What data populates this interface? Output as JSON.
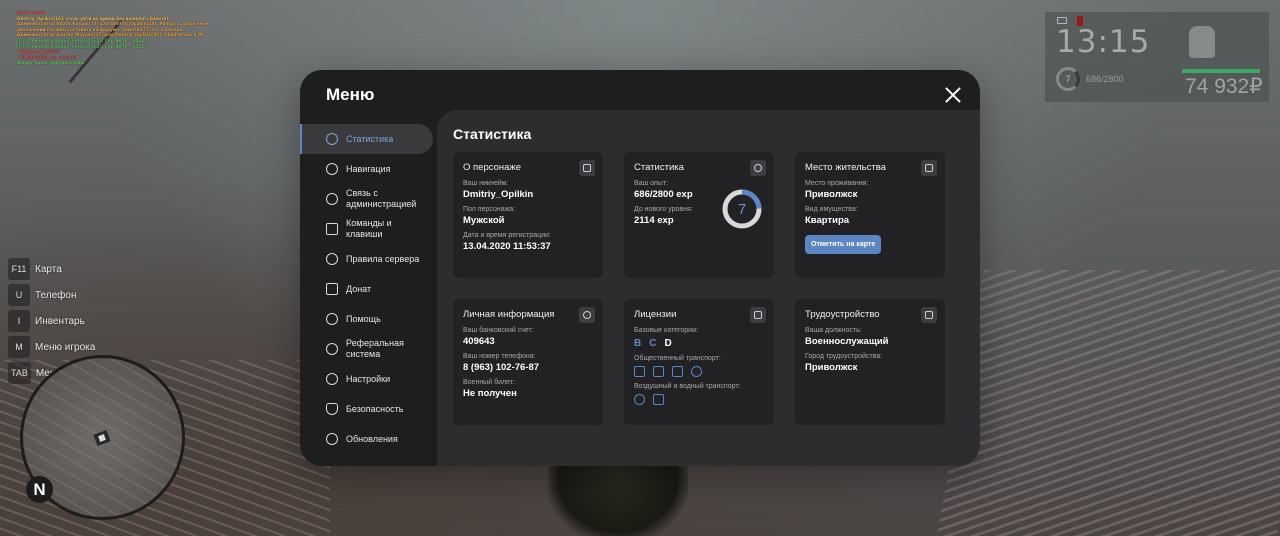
{
  "chat": [
    {
      "text": "Дым Финай",
      "color": "#e05050"
    },
    {
      "text": "Dmitriy_Opilkin[18]: а как уйти из армии без военного билета?",
      "color": "#f0c050"
    },
    {
      "text": "Администратор Nikita_Kanpai[73] для Dmitriy_Opilkin[48]: Рапорт о досрочном",
      "color": "#f0a040"
    },
    {
      "text": "увольнении службы составить на форуме. Заметил ГС.Ч.С о беседе.",
      "color": "#f0a040"
    },
    {
      "text": "Администратор Andrey_Milyaev[27] для Dmitriy_Opilkin[48]: Обратитесь к РС.",
      "color": "#f0a040"
    },
    {
      "text": "[C] Отличная Vladimir_Fetisov[165]: Сер ЯКТР - 2433 !!",
      "color": "#60c060"
    },
    {
      "text": "[C] Отличная Vladimir_Fetisov[165]: Сер ЯКТР - 2433 !!",
      "color": "#60c060"
    },
    {
      "text": "* Время: 11:50:57",
      "color": "#e05050"
    },
    {
      "text": "* 29.09.2020, Вс, 7:37:37",
      "color": "#e05050"
    },
    {
      "text": "Alexey_Loew: был разогнан.",
      "color": "#60d060"
    }
  ],
  "hud": {
    "time": "13:15",
    "level": "7",
    "exp": "686/2800",
    "money": "74 932₽",
    "health_fraction": 1.0
  },
  "keys": [
    {
      "key": "F11",
      "label": "Карта"
    },
    {
      "key": "U",
      "label": "Телефон"
    },
    {
      "key": "I",
      "label": "Инвентарь"
    },
    {
      "key": "M",
      "label": "Меню игрока"
    },
    {
      "key": "TAB",
      "label": "Меню взаимодействия"
    }
  ],
  "minimap": {
    "compass": "N"
  },
  "menu": {
    "title": "Меню",
    "sidebar": [
      {
        "label": "Статистика",
        "icon": "pie-chart-icon",
        "active": true
      },
      {
        "label": "Навигация",
        "icon": "compass-icon"
      },
      {
        "label": "Связь с администрацией",
        "icon": "headset-icon"
      },
      {
        "label": "Команды и клавиши",
        "icon": "document-icon"
      },
      {
        "label": "Правила сервера",
        "icon": "scales-icon"
      },
      {
        "label": "Донат",
        "icon": "wallet-icon"
      },
      {
        "label": "Помощь",
        "icon": "heart-hand-icon"
      },
      {
        "label": "Реферальная система",
        "icon": "people-icon"
      },
      {
        "label": "Настройки",
        "icon": "gear-icon"
      },
      {
        "label": "Безопасность",
        "icon": "shield-icon"
      },
      {
        "label": "Обновления",
        "icon": "refresh-icon"
      }
    ],
    "panel_title": "Статистика",
    "character": {
      "title": "О персонаже",
      "nickname_label": "Ваш никнейм:",
      "nickname": "Dmitriy_Opilkin",
      "sex_label": "Пол персонажа:",
      "sex": "Мужской",
      "reg_label": "Дата и время регистрации:",
      "reg": "13.04.2020 11:53:37"
    },
    "stats": {
      "title": "Статистика",
      "exp_label": "Ваш опыт:",
      "exp": "686/2800 exp",
      "next_label": "До нового уровня:",
      "next": "2114 exp",
      "level": "7",
      "progress": 0.245
    },
    "residence": {
      "title": "Место жительства",
      "place_label": "Место проживания:",
      "place": "Приволжск",
      "property_label": "Вид имущества:",
      "property": "Квартира",
      "button": "Отметить на карте"
    },
    "personal": {
      "title": "Личная информация",
      "bank_label": "Ваш банковский счет:",
      "bank": "409643",
      "phone_label": "Ваш номер телефона:",
      "phone": "8 (963) 102-76-87",
      "military_label": "Военный билет:",
      "military": "Не получен"
    },
    "licenses": {
      "title": "Лицензии",
      "base_label": "Базовые категории:",
      "categories": [
        "B",
        "C",
        "D"
      ],
      "public_label": "Общественный транспорт:",
      "air_label": "Воздушный и водный транспорт:"
    },
    "employment": {
      "title": "Трудоустройство",
      "position_label": "Ваша должность:",
      "position": "Военнослужащий",
      "city_label": "Город трудоустройства:",
      "city": "Приволжск"
    }
  }
}
